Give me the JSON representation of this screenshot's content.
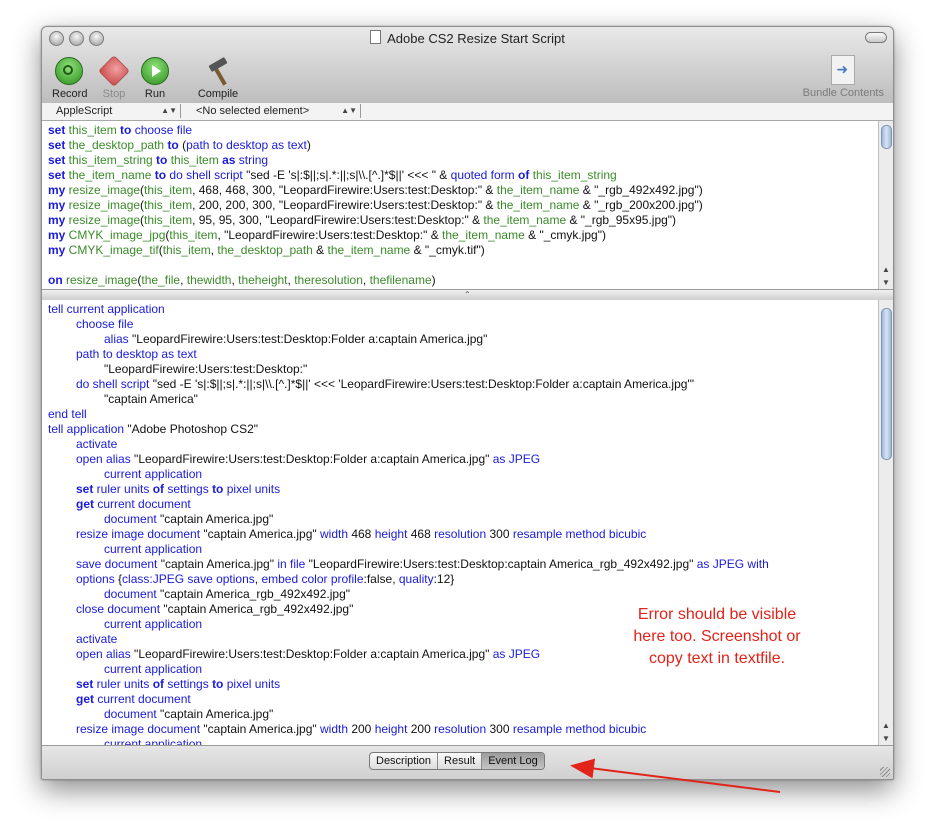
{
  "window": {
    "title": "Adobe CS2 Resize Start Script"
  },
  "toolbar": {
    "record_label": "Record",
    "stop_label": "Stop",
    "run_label": "Run",
    "compile_label": "Compile",
    "bundle_label": "Bundle Contents"
  },
  "navbar": {
    "language": "AppleScript",
    "element": "<No selected element>"
  },
  "script": {
    "lines": [
      {
        "indent": 0,
        "parts": [
          [
            "kw",
            "set"
          ],
          [
            "var",
            " this_item "
          ],
          [
            "kw",
            "to"
          ],
          [
            "cmd",
            " choose file"
          ]
        ]
      },
      {
        "indent": 0,
        "parts": [
          [
            "kw",
            "set"
          ],
          [
            "var",
            " the_desktop_path "
          ],
          [
            "kw",
            "to"
          ],
          [
            "lit",
            " ("
          ],
          [
            "cmd",
            "path to desktop as text"
          ],
          [
            "lit",
            ")"
          ]
        ]
      },
      {
        "indent": 0,
        "parts": [
          [
            "kw",
            "set"
          ],
          [
            "var",
            " this_item_string "
          ],
          [
            "kw",
            "to"
          ],
          [
            "var",
            " this_item "
          ],
          [
            "kw",
            "as"
          ],
          [
            "cmd",
            " string"
          ]
        ]
      },
      {
        "indent": 0,
        "parts": [
          [
            "kw",
            "set"
          ],
          [
            "var",
            " the_item_name "
          ],
          [
            "kw",
            "to"
          ],
          [
            "cmd",
            " do shell script"
          ],
          [
            "lit",
            " \"sed -E 's|:$||;s|.*:||;s|\\\\.[^.]*$||' <<< \" & "
          ],
          [
            "cmd",
            "quoted form"
          ],
          [
            "kw",
            " of"
          ],
          [
            "var",
            " this_item_string"
          ]
        ]
      },
      {
        "indent": 0,
        "parts": [
          [
            "kw",
            "my"
          ],
          [
            "var",
            " resize_image"
          ],
          [
            "lit",
            "("
          ],
          [
            "var",
            "this_item"
          ],
          [
            "lit",
            ", 468, 468, 300, \"LeopardFirewire:Users:test:Desktop:\" & "
          ],
          [
            "var",
            "the_item_name"
          ],
          [
            "lit",
            " & \"_rgb_492x492.jpg\")"
          ]
        ]
      },
      {
        "indent": 0,
        "parts": [
          [
            "kw",
            "my"
          ],
          [
            "var",
            " resize_image"
          ],
          [
            "lit",
            "("
          ],
          [
            "var",
            "this_item"
          ],
          [
            "lit",
            ", 200, 200, 300, \"LeopardFirewire:Users:test:Desktop:\" & "
          ],
          [
            "var",
            "the_item_name"
          ],
          [
            "lit",
            " & \"_rgb_200x200.jpg\")"
          ]
        ]
      },
      {
        "indent": 0,
        "parts": [
          [
            "kw",
            "my"
          ],
          [
            "var",
            " resize_image"
          ],
          [
            "lit",
            "("
          ],
          [
            "var",
            "this_item"
          ],
          [
            "lit",
            ", 95, 95, 300, \"LeopardFirewire:Users:test:Desktop:\" & "
          ],
          [
            "var",
            "the_item_name"
          ],
          [
            "lit",
            " & \"_rgb_95x95.jpg\")"
          ]
        ]
      },
      {
        "indent": 0,
        "parts": [
          [
            "kw",
            "my"
          ],
          [
            "var",
            " CMYK_image_jpg"
          ],
          [
            "lit",
            "("
          ],
          [
            "var",
            "this_item"
          ],
          [
            "lit",
            ", \"LeopardFirewire:Users:test:Desktop:\" & "
          ],
          [
            "var",
            "the_item_name"
          ],
          [
            "lit",
            " & \"_cmyk.jpg\")"
          ]
        ]
      },
      {
        "indent": 0,
        "parts": [
          [
            "kw",
            "my"
          ],
          [
            "var",
            " CMYK_image_tif"
          ],
          [
            "lit",
            "("
          ],
          [
            "var",
            "this_item"
          ],
          [
            "lit",
            ", "
          ],
          [
            "var",
            "the_desktop_path"
          ],
          [
            "lit",
            " & "
          ],
          [
            "var",
            "the_item_name"
          ],
          [
            "lit",
            " & \"_cmyk.tif\")"
          ]
        ]
      },
      {
        "indent": 0,
        "parts": []
      },
      {
        "indent": 0,
        "parts": [
          [
            "kw",
            "on"
          ],
          [
            "var",
            " resize_image"
          ],
          [
            "lit",
            "("
          ],
          [
            "var",
            "the_file"
          ],
          [
            "lit",
            ", "
          ],
          [
            "var",
            "thewidth"
          ],
          [
            "lit",
            ", "
          ],
          [
            "var",
            "theheight"
          ],
          [
            "lit",
            ", "
          ],
          [
            "var",
            "theresolution"
          ],
          [
            "lit",
            ", "
          ],
          [
            "var",
            "thefilename"
          ],
          [
            "lit",
            ")"
          ]
        ]
      },
      {
        "indent": 1,
        "parts": [
          [
            "kw",
            "tell"
          ],
          [
            "cmd",
            " application"
          ],
          [
            "lit",
            " \"Adobe Photoshop CS2\""
          ]
        ]
      }
    ]
  },
  "event_log": {
    "lines": [
      {
        "indent": 0,
        "parts": [
          [
            "cmd",
            "tell current application"
          ]
        ]
      },
      {
        "indent": 1,
        "parts": [
          [
            "cmd",
            "choose file"
          ]
        ]
      },
      {
        "indent": 2,
        "parts": [
          [
            "cmd",
            "alias"
          ],
          [
            "lit",
            " \"LeopardFirewire:Users:test:Desktop:Folder a:captain America.jpg\""
          ]
        ]
      },
      {
        "indent": 1,
        "parts": [
          [
            "cmd",
            "path to desktop as text"
          ]
        ]
      },
      {
        "indent": 2,
        "parts": [
          [
            "lit",
            "\"LeopardFirewire:Users:test:Desktop:\""
          ]
        ]
      },
      {
        "indent": 1,
        "parts": [
          [
            "cmd",
            "do shell script"
          ],
          [
            "lit",
            " \"sed -E 's|:$||;s|.*:||;s|\\\\.[^.]*$||' <<< 'LeopardFirewire:Users:test:Desktop:Folder a:captain America.jpg'\""
          ]
        ]
      },
      {
        "indent": 2,
        "parts": [
          [
            "lit",
            "\"captain America\""
          ]
        ]
      },
      {
        "indent": 0,
        "parts": [
          [
            "cmd",
            "end tell"
          ]
        ]
      },
      {
        "indent": 0,
        "parts": [
          [
            "cmd",
            "tell application"
          ],
          [
            "lit",
            " \"Adobe Photoshop CS2\""
          ]
        ]
      },
      {
        "indent": 1,
        "parts": [
          [
            "cmd",
            "activate"
          ]
        ]
      },
      {
        "indent": 1,
        "parts": [
          [
            "cmd",
            "open alias"
          ],
          [
            "lit",
            " \"LeopardFirewire:Users:test:Desktop:Folder a:captain America.jpg\" "
          ],
          [
            "cmd",
            "as JPEG"
          ]
        ]
      },
      {
        "indent": 2,
        "parts": [
          [
            "cmd",
            "current application"
          ]
        ]
      },
      {
        "indent": 1,
        "parts": [
          [
            "kw",
            "set"
          ],
          [
            "cmd",
            " ruler units "
          ],
          [
            "kw",
            "of"
          ],
          [
            "cmd",
            " settings "
          ],
          [
            "kw",
            "to"
          ],
          [
            "cmd",
            " pixel units"
          ]
        ]
      },
      {
        "indent": 1,
        "parts": [
          [
            "kw",
            "get"
          ],
          [
            "cmd",
            " current document"
          ]
        ]
      },
      {
        "indent": 2,
        "parts": [
          [
            "cmd",
            "document"
          ],
          [
            "lit",
            " \"captain America.jpg\""
          ]
        ]
      },
      {
        "indent": 1,
        "parts": [
          [
            "cmd",
            "resize image document"
          ],
          [
            "lit",
            " \"captain America.jpg\" "
          ],
          [
            "cmd",
            "width"
          ],
          [
            "lit",
            " 468 "
          ],
          [
            "cmd",
            "height"
          ],
          [
            "lit",
            " 468 "
          ],
          [
            "cmd",
            "resolution"
          ],
          [
            "lit",
            " 300 "
          ],
          [
            "cmd",
            "resample method bicubic"
          ]
        ]
      },
      {
        "indent": 2,
        "parts": [
          [
            "cmd",
            "current application"
          ]
        ]
      },
      {
        "indent": 1,
        "parts": [
          [
            "cmd",
            "save document"
          ],
          [
            "lit",
            " \"captain America.jpg\" "
          ],
          [
            "cmd",
            "in file"
          ],
          [
            "lit",
            " \"LeopardFirewire:Users:test:Desktop:captain America_rgb_492x492.jpg\" "
          ],
          [
            "cmd",
            "as JPEG with"
          ]
        ]
      },
      {
        "indent": 1,
        "parts": [
          [
            "cmd",
            "options"
          ],
          [
            "lit",
            " {"
          ],
          [
            "cmd",
            "class:JPEG save options"
          ],
          [
            "lit",
            ", "
          ],
          [
            "cmd",
            "embed color profile"
          ],
          [
            "lit",
            ":false, "
          ],
          [
            "cmd",
            "quality"
          ],
          [
            "lit",
            ":12}"
          ]
        ]
      },
      {
        "indent": 2,
        "parts": [
          [
            "cmd",
            "document"
          ],
          [
            "lit",
            " \"captain America_rgb_492x492.jpg\""
          ]
        ]
      },
      {
        "indent": 1,
        "parts": [
          [
            "cmd",
            "close document"
          ],
          [
            "lit",
            " \"captain America_rgb_492x492.jpg\""
          ]
        ]
      },
      {
        "indent": 2,
        "parts": [
          [
            "cmd",
            "current application"
          ]
        ]
      },
      {
        "indent": 1,
        "parts": [
          [
            "cmd",
            "activate"
          ]
        ]
      },
      {
        "indent": 1,
        "parts": [
          [
            "cmd",
            "open alias"
          ],
          [
            "lit",
            " \"LeopardFirewire:Users:test:Desktop:Folder a:captain America.jpg\" "
          ],
          [
            "cmd",
            "as JPEG"
          ]
        ]
      },
      {
        "indent": 2,
        "parts": [
          [
            "cmd",
            "current application"
          ]
        ]
      },
      {
        "indent": 1,
        "parts": [
          [
            "kw",
            "set"
          ],
          [
            "cmd",
            " ruler units "
          ],
          [
            "kw",
            "of"
          ],
          [
            "cmd",
            " settings "
          ],
          [
            "kw",
            "to"
          ],
          [
            "cmd",
            " pixel units"
          ]
        ]
      },
      {
        "indent": 1,
        "parts": [
          [
            "kw",
            "get"
          ],
          [
            "cmd",
            " current document"
          ]
        ]
      },
      {
        "indent": 2,
        "parts": [
          [
            "cmd",
            "document"
          ],
          [
            "lit",
            " \"captain America.jpg\""
          ]
        ]
      },
      {
        "indent": 1,
        "parts": [
          [
            "cmd",
            "resize image document"
          ],
          [
            "lit",
            " \"captain America.jpg\" "
          ],
          [
            "cmd",
            "width"
          ],
          [
            "lit",
            " 200 "
          ],
          [
            "cmd",
            "height"
          ],
          [
            "lit",
            " 200 "
          ],
          [
            "cmd",
            "resolution"
          ],
          [
            "lit",
            " 300 "
          ],
          [
            "cmd",
            "resample method bicubic"
          ]
        ]
      },
      {
        "indent": 2,
        "parts": [
          [
            "cmd",
            "current application"
          ]
        ]
      }
    ]
  },
  "bottom_tabs": [
    "Description",
    "Result",
    "Event Log"
  ],
  "annotation": {
    "line1": "Error should be visible",
    "line2": "here too.  Screenshot or",
    "line3": "copy text in textfile."
  },
  "colors": {
    "keyword": "#1a1adb",
    "variable": "#3b8a2a",
    "annotation": "#e2231a"
  }
}
